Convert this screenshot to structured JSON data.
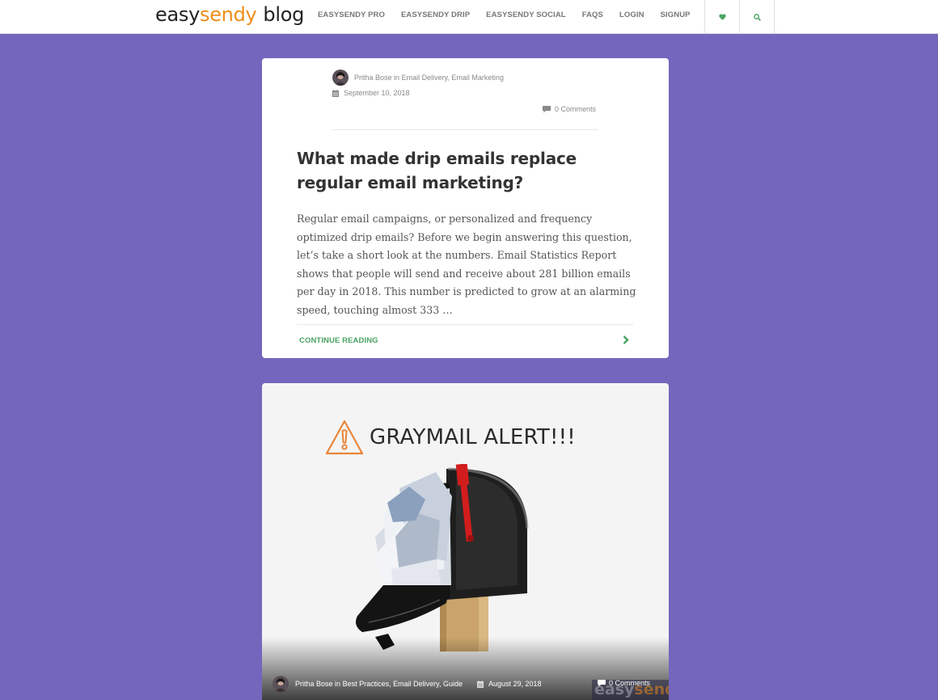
{
  "header": {
    "logo": {
      "part1": "easy",
      "part2": "sendy",
      "part3": "blog"
    },
    "nav": [
      "EASYSENDY PRO",
      "EASYSENDY DRIP",
      "EASYSENDY SOCIAL",
      "FAQS",
      "LOGIN",
      "SIGNUP"
    ],
    "icons": [
      "heart-icon",
      "search-icon"
    ]
  },
  "post1": {
    "author": "Pritha Bose",
    "in_text": "in",
    "categories": "Email Delivery, Email Marketing",
    "date": "September 10, 2018",
    "comments": "0 Comments",
    "title": "What made drip emails replace regular email marketing?",
    "excerpt": "Regular email campaigns, or personalized and frequency optimized drip emails? Before we begin answering this question, let’s take a short look at the numbers. Email Statistics Report shows that people will send and receive about 281 billion emails per day in 2018. This number is predicted to grow at an alarming speed, touching almost 333 …",
    "continue_label": "CONTINUE READING"
  },
  "post2": {
    "image_headline": "GRAYMAIL ALERT!!!",
    "author": "Pritha Bose",
    "in_text": "in",
    "categories": "Best Practices, Email Delivery, Guide",
    "date": "August 29, 2018",
    "comments": "0 Comments",
    "watermark": {
      "part1": "easy",
      "part2": "sendy"
    }
  },
  "colors": {
    "background": "#7466bd",
    "accent_green": "#4aa463",
    "logo_orange": "#f08c1a"
  }
}
